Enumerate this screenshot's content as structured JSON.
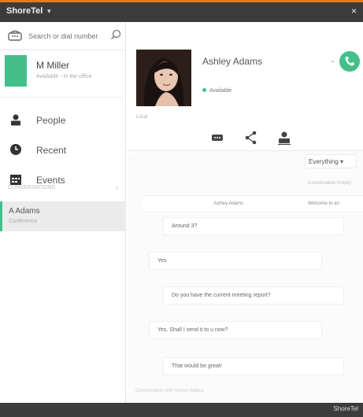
{
  "titlebar": {
    "title": "ShoreTel",
    "close": "×"
  },
  "search": {
    "placeholder": "Search or dial number"
  },
  "user": {
    "name": "M Miller",
    "status": "Available - In the office"
  },
  "nav": [
    {
      "label": "People",
      "icon": "person-icon"
    },
    {
      "label": "Recent",
      "icon": "clock-icon"
    },
    {
      "label": "Events",
      "icon": "calendar-icon"
    }
  ],
  "section": {
    "label": "CONVERSATIONS",
    "caret": "›"
  },
  "conversation": {
    "name": "A Adams",
    "sub": "Conference"
  },
  "contact": {
    "name": "Ashley Adams",
    "presence": "Available",
    "note": "Local",
    "call_caret": "⌄"
  },
  "actions": [
    "chat-icon",
    "share-icon",
    "contact-card-icon"
  ],
  "filter": {
    "selected": "Everything ▾"
  },
  "meta": "Conversation history",
  "table": {
    "col1": "Ashley Adams",
    "col2": "Welcome to an"
  },
  "messages": [
    "Around 3?",
    "Yes",
    "Do you have the current meeting report?",
    "Yes. Shall I send it to u now?",
    "That would be great!"
  ],
  "footer": "Conversation with Ashley Adams",
  "brand": "ShoreTel",
  "colors": {
    "accent": "#45bf8a",
    "titlebar": "#3c3c3c",
    "border_top": "#e07b24"
  }
}
